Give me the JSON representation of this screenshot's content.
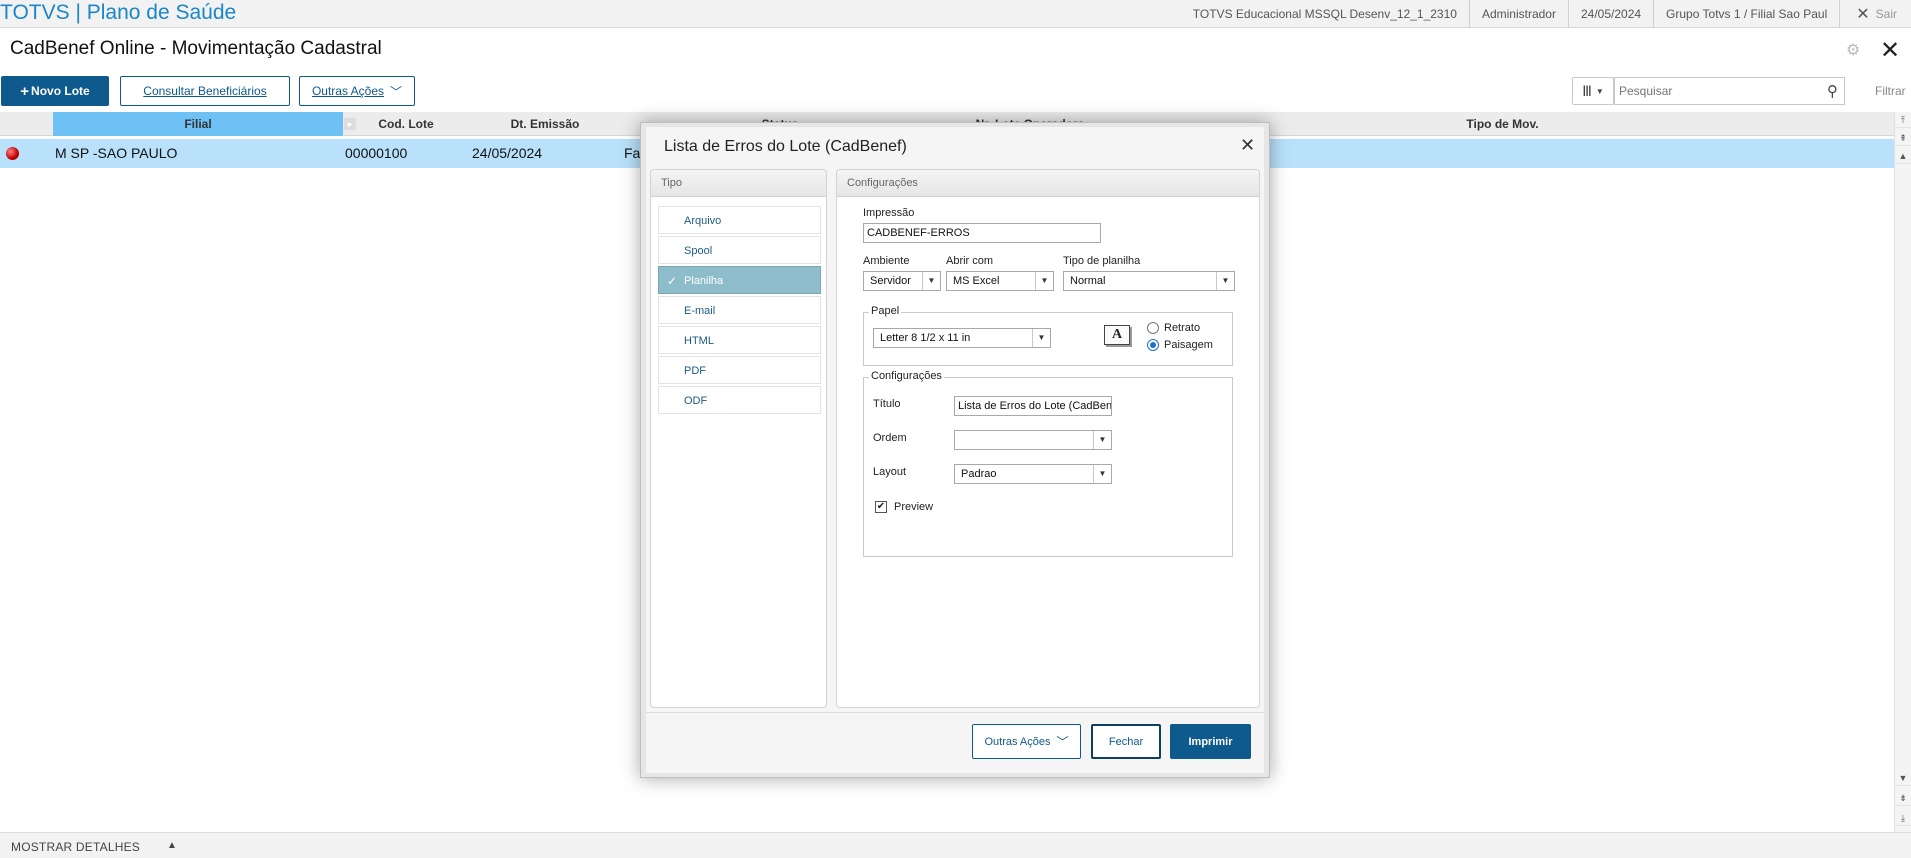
{
  "topbar": {
    "app_title": "TOTVS | Plano de Saúde",
    "environment": "TOTVS Educacional MSSQL Desenv_12_1_2310",
    "user": "Administrador",
    "date": "24/05/2024",
    "branch": "Grupo Totvs 1 / Filial Sao Paul",
    "logout_label": "Sair"
  },
  "page": {
    "title": "CadBenef Online - Movimentação Cadastral",
    "new_batch_label": "Novo Lote",
    "consult_label": "Consultar Beneficiários",
    "other_actions_label": "Outras Ações",
    "search_placeholder": "Pesquisar",
    "filter_label": "Filtrar"
  },
  "grid": {
    "columns": [
      "Filial",
      "Cod. Lote",
      "Dt. Emissão",
      "Status",
      "Nr. Lote Operadora",
      "Tipo de Mov."
    ],
    "selected_column": "Filial",
    "rows": [
      {
        "status": "error",
        "filial": "M SP -SAO PAULO",
        "cod_lote": "00000100",
        "dt_emissao": "24/05/2024",
        "status_text": "Fa"
      }
    ]
  },
  "bottom": {
    "details_label": "MOSTRAR DETALHES"
  },
  "dialog": {
    "title": "Lista de Erros do Lote (CadBenef)",
    "tipo_header": "Tipo",
    "config_header": "Configurações",
    "tipo_items": [
      "Arquivo",
      "Spool",
      "Planilha",
      "E-mail",
      "HTML",
      "PDF",
      "ODF"
    ],
    "tipo_selected": "Planilha",
    "impressao_label": "Impressão",
    "impressao_value": "CADBENEF-ERROS",
    "ambiente_label": "Ambiente",
    "ambiente_value": "Servidor",
    "abrir_com_label": "Abrir com",
    "abrir_com_value": "MS Excel",
    "tipo_planilha_label": "Tipo de planilha",
    "tipo_planilha_value": "Normal",
    "papel_legend": "Papel",
    "papel_value": "Letter 8 1/2 x 11 in",
    "orientation_options": [
      "Retrato",
      "Paisagem"
    ],
    "orientation_selected": "Paisagem",
    "config_legend": "Configurações",
    "titulo_label": "Título",
    "titulo_value": "Lista de Erros do Lote (CadBenef)",
    "ordem_label": "Ordem",
    "ordem_value": "",
    "layout_label": "Layout",
    "layout_value": "Padrao",
    "preview_label": "Preview",
    "preview_checked": true,
    "btn_other_actions": "Outras Ações",
    "btn_close": "Fechar",
    "btn_print": "Imprimir"
  },
  "colors": {
    "brand_blue": "#1a86c8",
    "primary_button": "#0e5a8c",
    "header_selected": "#6ec1f5",
    "row_selected": "#b9e1fb",
    "tipo_active": "#8dbccb"
  }
}
